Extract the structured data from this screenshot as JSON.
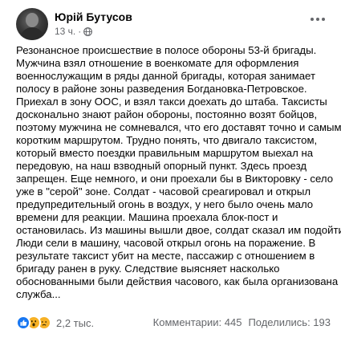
{
  "post": {
    "author": "Юрій Бутусов",
    "time": "13 ч.",
    "separator": "·",
    "audience_icon": "globe-icon",
    "more_icon": "more-options-icon",
    "text_lines": [
      "Резонансное происшествие в полосе обороны 53-й бригады.",
      "Мужчина взял отношение в военкомате для оформления",
      "военнослужащим в ряды данной бригады, которая занимает",
      "полосу в районе зоны разведения Богдановка-Петровское.",
      "Приехал в зону ООС, и взял такси доехать до штаба. Таксисты",
      "досконально знают район обороны, постоянно возят бойцов,",
      "поэтому мужчина не сомневался, что его доставят точно и самым",
      "коротким маршрутом. Трудно понять, что двигало таксистом,",
      "который вместо поездки правильным маршрутом выехал на",
      "передовую, на наш взводный опорный пункт. Здесь проезд",
      "запрещен. Еще немного, и они проехали бы в Викторовку - село",
      "уже в \"серой\" зоне. Солдат - часовой среагировал и открыл",
      "предупредительный огонь в воздух, у него было очень мало",
      "времени для реакции. Машина проехала блок-пост и",
      "остановилась. Из машины вышли двое, солдат сказал им подойти.",
      "Люди сели в машину, часовой открыл огонь на поражение. В",
      "результате таксист убит на месте, пассажир с отношением в",
      "бригаду ранен в руку. Следствие выясняет насколько",
      "обоснованными были действия часового, как была организована",
      "служба..."
    ]
  },
  "footer": {
    "reaction_icons": [
      "like-icon",
      "wow-icon",
      "sad-icon"
    ],
    "reactions_count": "2,2 тыс.",
    "comments": "Комментарии: 445",
    "shares": "Поделились: 193"
  },
  "colors": {
    "like_blue": "#1877f2",
    "emoji_yellow": "#f7b125",
    "secondary_text": "#65676b",
    "primary_text": "#050505"
  }
}
